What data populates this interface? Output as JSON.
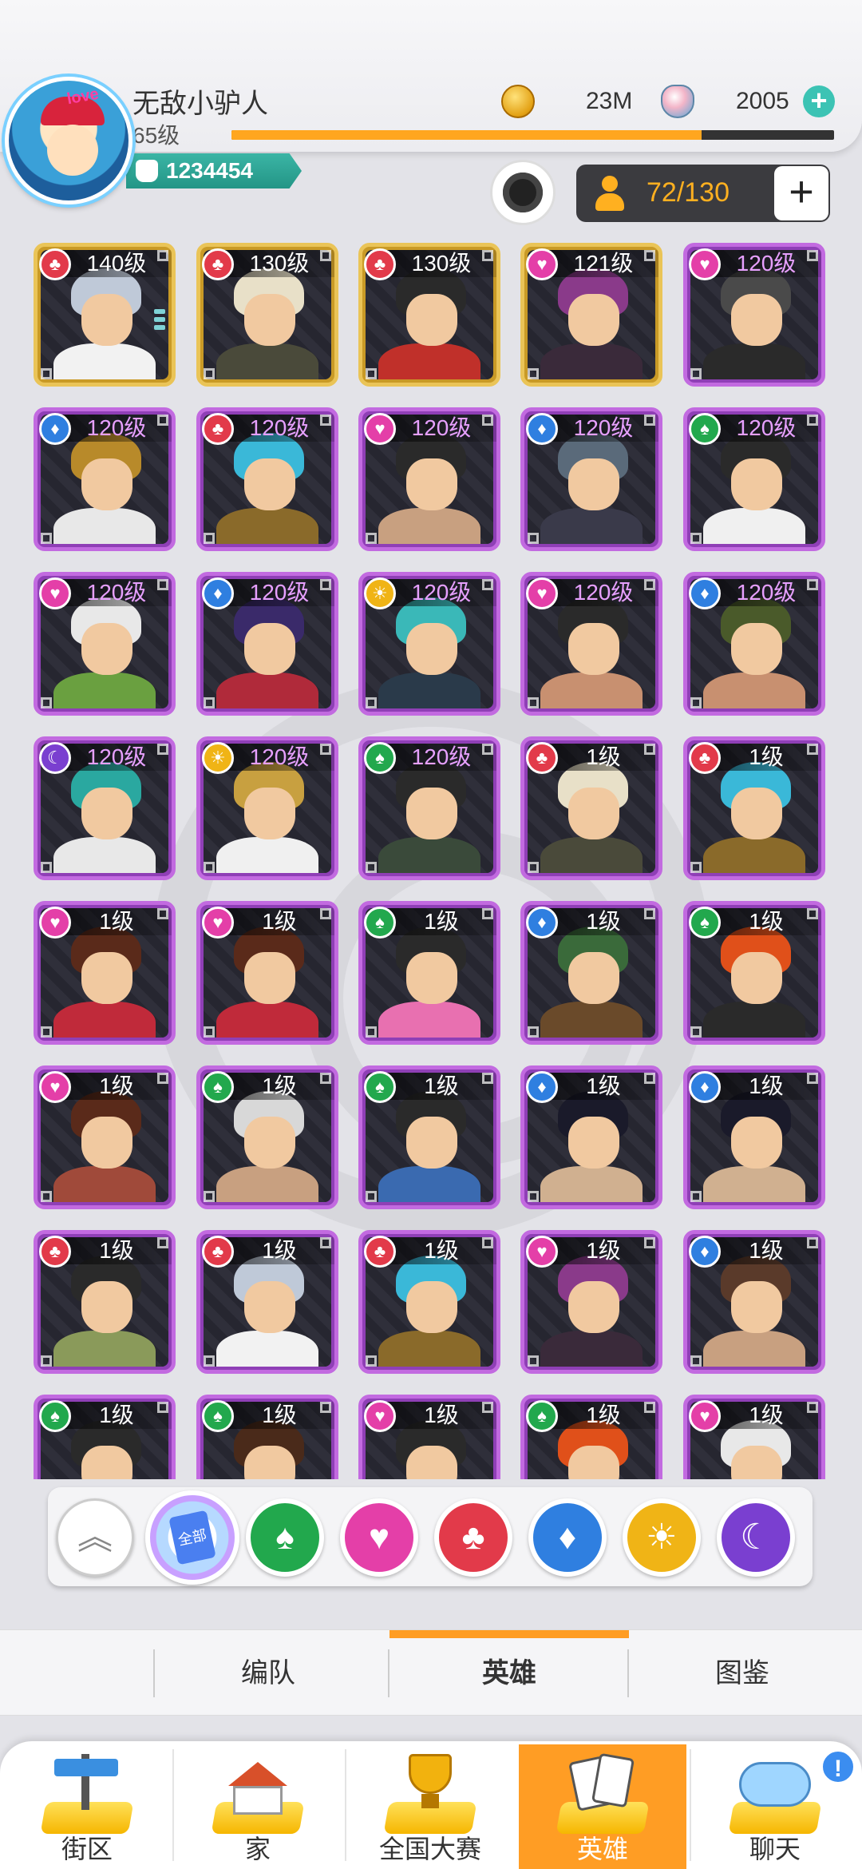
{
  "player": {
    "name": "无敌小驴人",
    "level": "65级",
    "power": "1234454",
    "xp_fraction": 0.78,
    "avatar_badge": "love"
  },
  "currency": {
    "coins": "23M",
    "gems": "2005"
  },
  "hero_capacity": "72/130",
  "colors": {
    "accent": "#ff9d24",
    "gold_card": "#eac457",
    "purple_card": "#c26ae0",
    "header_bg": "#f7f7f9"
  },
  "heroes": [
    {
      "level": "140级",
      "suit": "red",
      "frame": "gold",
      "hair": "#bfc9d8",
      "body": "#f2f2f2"
    },
    {
      "level": "130级",
      "suit": "red",
      "frame": "gold",
      "hair": "#e8e0c8",
      "body": "#4a4a3a"
    },
    {
      "level": "130级",
      "suit": "red",
      "frame": "gold",
      "hair": "#2a2a2a",
      "body": "#c0302a"
    },
    {
      "level": "121级",
      "suit": "pink",
      "frame": "gold",
      "hair": "#8a3a8a",
      "body": "#3a2a3a"
    },
    {
      "level": "120级",
      "suit": "pink",
      "frame": "purple",
      "hair": "#4a4a4a",
      "body": "#2a2a2a"
    },
    {
      "level": "120级",
      "suit": "blue",
      "frame": "purple",
      "hair": "#b88a2a",
      "body": "#e8e8e8"
    },
    {
      "level": "120级",
      "suit": "red",
      "frame": "purple",
      "hair": "#3ab8d8",
      "body": "#8a6a2a"
    },
    {
      "level": "120级",
      "suit": "pink",
      "frame": "purple",
      "hair": "#2a2a2a",
      "body": "#c8a080"
    },
    {
      "level": "120级",
      "suit": "blue",
      "frame": "purple",
      "hair": "#5a6a7a",
      "body": "#3a3a4a"
    },
    {
      "level": "120级",
      "suit": "green",
      "frame": "purple",
      "hair": "#2a2a2a",
      "body": "#f0f0f0"
    },
    {
      "level": "120级",
      "suit": "pink",
      "frame": "purple",
      "hair": "#e8e8e8",
      "body": "#6aa040"
    },
    {
      "level": "120级",
      "suit": "blue",
      "frame": "purple",
      "hair": "#3a2a6a",
      "body": "#b02a3a"
    },
    {
      "level": "120级",
      "suit": "gold",
      "frame": "purple",
      "hair": "#3ab8b8",
      "body": "#2a3a4a"
    },
    {
      "level": "120级",
      "suit": "pink",
      "frame": "purple",
      "hair": "#2a2a2a",
      "body": "#c89070"
    },
    {
      "level": "120级",
      "suit": "blue",
      "frame": "purple",
      "hair": "#4a5a2a",
      "body": "#c89070"
    },
    {
      "level": "120级",
      "suit": "moon",
      "frame": "purple",
      "hair": "#2aa8a0",
      "body": "#e8e8e8"
    },
    {
      "level": "120级",
      "suit": "gold",
      "frame": "purple",
      "hair": "#c8a040",
      "body": "#f0f0f0"
    },
    {
      "level": "120级",
      "suit": "green",
      "frame": "purple",
      "hair": "#2a2a2a",
      "body": "#3a4a3a"
    },
    {
      "level": "1级",
      "suit": "red",
      "frame": "purple",
      "hair": "#e8e0c8",
      "body": "#4a4a3a"
    },
    {
      "level": "1级",
      "suit": "red",
      "frame": "purple",
      "hair": "#3ab8d8",
      "body": "#8a6a2a"
    },
    {
      "level": "1级",
      "suit": "pink",
      "frame": "purple",
      "hair": "#5a2a1a",
      "body": "#c02a3a"
    },
    {
      "level": "1级",
      "suit": "pink",
      "frame": "purple",
      "hair": "#5a2a1a",
      "body": "#c02a3a"
    },
    {
      "level": "1级",
      "suit": "green",
      "frame": "purple",
      "hair": "#2a2a2a",
      "body": "#e870b0"
    },
    {
      "level": "1级",
      "suit": "blue",
      "frame": "purple",
      "hair": "#3a6a3a",
      "body": "#6a4a2a"
    },
    {
      "level": "1级",
      "suit": "green",
      "frame": "purple",
      "hair": "#e0501a",
      "body": "#2a2a2a"
    },
    {
      "level": "1级",
      "suit": "pink",
      "frame": "purple",
      "hair": "#5a2a1a",
      "body": "#a04a3a"
    },
    {
      "level": "1级",
      "suit": "green",
      "frame": "purple",
      "hair": "#d8d8d8",
      "body": "#c8a080"
    },
    {
      "level": "1级",
      "suit": "green",
      "frame": "purple",
      "hair": "#2a2a2a",
      "body": "#3a6ab0"
    },
    {
      "level": "1级",
      "suit": "blue",
      "frame": "purple",
      "hair": "#1a1a2a",
      "body": "#d0b090"
    },
    {
      "level": "1级",
      "suit": "blue",
      "frame": "purple",
      "hair": "#1a1a2a",
      "body": "#d0b090"
    },
    {
      "level": "1级",
      "suit": "red",
      "frame": "purple",
      "hair": "#2a2a2a",
      "body": "#8a9a5a"
    },
    {
      "level": "1级",
      "suit": "red",
      "frame": "purple",
      "hair": "#bfc9d8",
      "body": "#f2f2f2"
    },
    {
      "level": "1级",
      "suit": "red",
      "frame": "purple",
      "hair": "#3ab8d8",
      "body": "#8a6a2a"
    },
    {
      "level": "1级",
      "suit": "pink",
      "frame": "purple",
      "hair": "#8a3a8a",
      "body": "#3a2a3a"
    },
    {
      "level": "1级",
      "suit": "blue",
      "frame": "purple",
      "hair": "#5a3a2a",
      "body": "#c8a080"
    },
    {
      "level": "1级",
      "suit": "green",
      "frame": "purple",
      "hair": "#2a2a2a",
      "body": "#c8a080"
    },
    {
      "level": "1级",
      "suit": "green",
      "frame": "purple",
      "hair": "#4a2a1a",
      "body": "#6a3a2a"
    },
    {
      "level": "1级",
      "suit": "pink",
      "frame": "purple",
      "hair": "#2a2a2a",
      "body": "#c8a080"
    },
    {
      "level": "1级",
      "suit": "green",
      "frame": "purple",
      "hair": "#e0501a",
      "body": "#2a2a2a"
    },
    {
      "level": "1级",
      "suit": "pink",
      "frame": "purple",
      "hair": "#e8e8e8",
      "body": "#6aa040"
    }
  ],
  "filters": {
    "all_label": "全部",
    "items": [
      {
        "name": "collapse-filter-button",
        "icon": "chevron-up-icon"
      },
      {
        "name": "filter-all-button",
        "icon": "cards-icon"
      },
      {
        "name": "filter-spade-button",
        "icon": "spade-icon",
        "color": "#22a84d"
      },
      {
        "name": "filter-heart-button",
        "icon": "heart-icon",
        "color": "#e43fa8"
      },
      {
        "name": "filter-club-button",
        "icon": "club-icon",
        "color": "#e23a4a"
      },
      {
        "name": "filter-diamond-button",
        "icon": "diamond-icon",
        "color": "#2f7fe0"
      },
      {
        "name": "filter-sun-button",
        "icon": "sun-icon",
        "color": "#f0b416"
      },
      {
        "name": "filter-moon-button",
        "icon": "moon-icon",
        "color": "#7a3fd0"
      }
    ]
  },
  "tabs": [
    {
      "label": "编队",
      "active": false
    },
    {
      "label": "英雄",
      "active": true
    },
    {
      "label": "图鉴",
      "active": false
    }
  ],
  "nav": [
    {
      "label": "街区",
      "icon": "signpost-icon",
      "active": false
    },
    {
      "label": "家",
      "icon": "house-icon",
      "active": false
    },
    {
      "label": "全国大赛",
      "icon": "trophy-icon",
      "active": false
    },
    {
      "label": "英雄",
      "icon": "hero-cards-icon",
      "active": true
    },
    {
      "label": "聊天",
      "icon": "chat-bubble-icon",
      "active": false
    }
  ],
  "notice_badge": "!"
}
